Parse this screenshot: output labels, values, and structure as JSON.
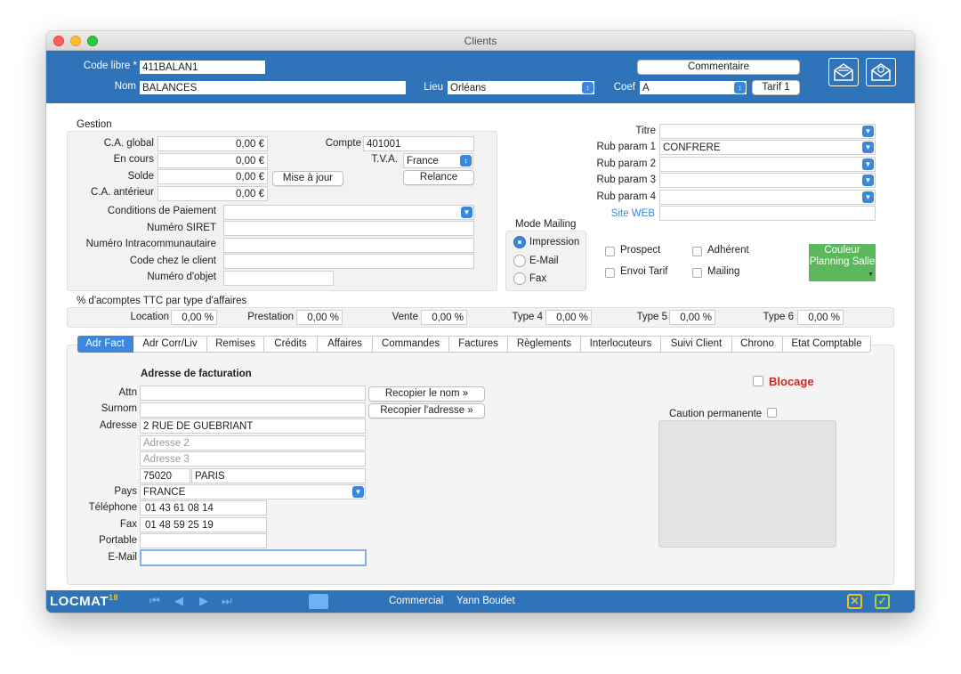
{
  "window": {
    "title": "Clients"
  },
  "header": {
    "code_label": "Code libre *",
    "code_value": "411BALAN1",
    "nom_label": "Nom",
    "nom_value": "BALANCES",
    "lieu_label": "Lieu",
    "lieu_value": "Orléans",
    "coef_label": "Coef",
    "coef_value": "A",
    "tarif_button": "Tarif 1",
    "commentaire_button": "Commentaire"
  },
  "gestion": {
    "title": "Gestion",
    "ca_global_label": "C.A. global",
    "ca_global": "0,00 €",
    "en_cours_label": "En cours",
    "en_cours": "0,00 €",
    "solde_label": "Solde",
    "solde": "0,00 €",
    "ca_anterieur_label": "C.A. antérieur",
    "ca_anterieur": "0,00 €",
    "mise_a_jour": "Mise à jour",
    "compte_label": "Compte",
    "compte": "401001",
    "tva_label": "T.V.A.",
    "tva": "France",
    "relance": "Relance",
    "conditions_label": "Conditions de Paiement",
    "siret_label": "Numéro SIRET",
    "intracom_label": "Numéro Intracommunautaire",
    "code_client_label": "Code chez le client",
    "objet_label": "Numéro d'objet"
  },
  "mailing": {
    "title": "Mode Mailing",
    "options": [
      "Impression",
      "E-Mail",
      "Fax"
    ],
    "selected": "Impression"
  },
  "params": {
    "titre_label": "Titre",
    "rub1_label": "Rub param 1",
    "rub1": "CONFRERE",
    "rub2_label": "Rub param 2",
    "rub3_label": "Rub param 3",
    "rub4_label": "Rub param 4",
    "site_label": "Site WEB",
    "prospect": "Prospect",
    "adherent": "Adhérent",
    "envoi_tarif": "Envoi Tarif",
    "mailing": "Mailing",
    "couleur_button": "Couleur Planning Salle",
    "couleur_color": "#5cb85c"
  },
  "acomptes": {
    "title": "% d'acomptes TTC par type d'affaires",
    "items": [
      {
        "label": "Location",
        "value": "0,00 %"
      },
      {
        "label": "Prestation",
        "value": "0,00 %"
      },
      {
        "label": "Vente",
        "value": "0,00 %"
      },
      {
        "label": "Type 4",
        "value": "0,00 %"
      },
      {
        "label": "Type 5",
        "value": "0,00 %"
      },
      {
        "label": "Type 6",
        "value": "0,00 %"
      }
    ]
  },
  "tabs": [
    "Adr Fact",
    "Adr Corr/Liv",
    "Remises",
    "Crédits",
    "Affaires",
    "Commandes",
    "Factures",
    "Règlements",
    "Interlocuteurs",
    "Suivi Client",
    "Chrono",
    "Etat Comptable"
  ],
  "address": {
    "title": "Adresse de facturation",
    "attn_label": "Attn",
    "surnom_label": "Surnom",
    "adresse_label": "Adresse",
    "adresse1": "2 RUE DE GUEBRIANT",
    "adresse2_placeholder": "Adresse 2",
    "adresse3_placeholder": "Adresse 3",
    "cp": "75020",
    "ville": "PARIS",
    "pays_label": "Pays",
    "pays": "FRANCE",
    "tel_label": "Téléphone",
    "tel": "01 43 61 08 14",
    "fax_label": "Fax",
    "fax": "01 48 59 25 19",
    "portable_label": "Portable",
    "email_label": "E-Mail",
    "recopier_nom": "Recopier le nom »",
    "recopier_adresse": "Recopier l'adresse »",
    "blocage": "Blocage",
    "caution": "Caution permanente"
  },
  "footer": {
    "logo": "LOCMAT",
    "logo_sup": "18",
    "role": "Commercial",
    "user": "Yann Boudet"
  },
  "colors": {
    "accent": "#2f73b8",
    "select": "#3b87e0",
    "blocage": "#d0271d"
  }
}
